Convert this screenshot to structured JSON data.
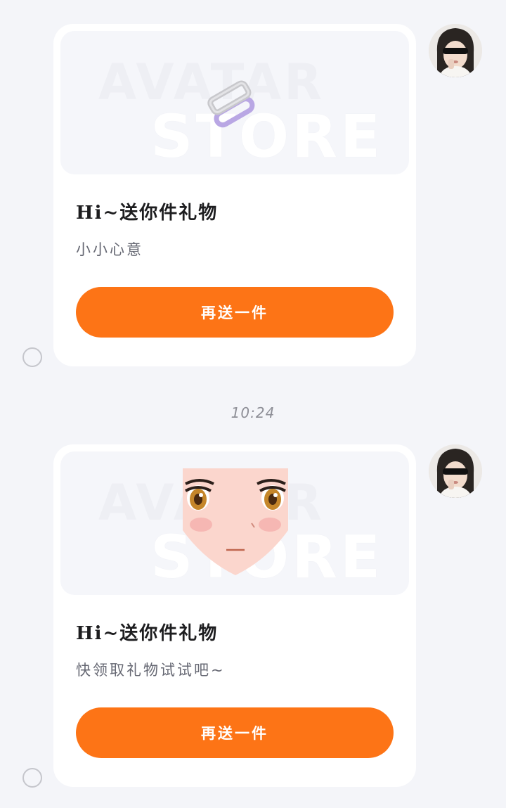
{
  "messages": [
    {
      "card_title": "Hi~送你件礼物",
      "card_subtitle": "小小心意",
      "button_label": "再送一件",
      "banner_watermark_top": "AVATAR",
      "banner_watermark_bottom": "STORE",
      "gift_icon": "hair-clip-icon",
      "avatar_icon": "user-avatar-icon"
    },
    {
      "card_title": "Hi~送你件礼物",
      "card_subtitle": "快领取礼物试试吧~",
      "button_label": "再送一件",
      "banner_watermark_top": "AVATAR",
      "banner_watermark_bottom": "STORE",
      "gift_icon": "anime-face-icon",
      "avatar_icon": "user-avatar-icon"
    }
  ],
  "timestamp": "10:24",
  "colors": {
    "background": "#f4f5f9",
    "card": "#ffffff",
    "button": "#fd7416",
    "button_text": "#ffffff",
    "title_text": "#1d1d1f",
    "subtitle_text": "#666873"
  }
}
